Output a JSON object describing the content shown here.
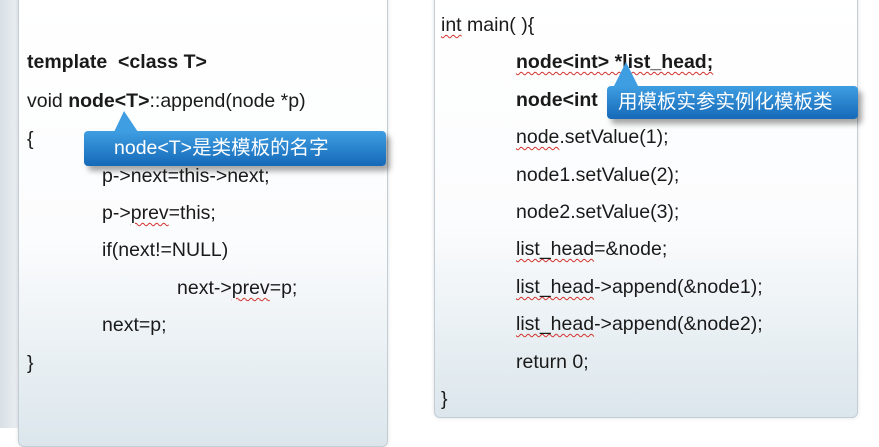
{
  "left_code": {
    "template_line": {
      "keyword": "template",
      "gap": "  ",
      "params": "<class T>"
    },
    "void_line": {
      "void": "void ",
      "node_t": "node<T>",
      "rest": "::append(node *p)"
    },
    "open_brace": "{",
    "line_next": {
      "part1": "p->",
      "part2": "next=this->next;"
    },
    "line_prev": {
      "part1": "p->",
      "prev": "prev",
      "part2": "=this;"
    },
    "line_if": "if(next!=NULL)",
    "line_next_prev": {
      "part1": "next->",
      "prev": "prev",
      "part2": "=p;"
    },
    "line_next_eq": "next=p;",
    "close_brace": "}"
  },
  "right_code": {
    "main_line": {
      "int": "int",
      "rest": " main( ){"
    },
    "decl1": {
      "text": "node<int> *list_head;"
    },
    "decl2": {
      "text": "node<int"
    },
    "set1": {
      "node": "node",
      "rest": ".setValue(1);"
    },
    "set2": "node1.setValue(2);",
    "set3": "node2.setValue(3);",
    "assign": {
      "list_head": "list_head",
      "rest": "=&node;"
    },
    "append1": {
      "list_head": "list_head",
      "rest": "->append(&node1);"
    },
    "append2": {
      "list_head": "list_head",
      "rest": "->append(&node2);"
    },
    "ret": "return 0;",
    "close_brace": "}"
  },
  "callouts": {
    "node_name": "node<T>是类模板的名字",
    "instantiate": "用模板实参实例化模板类"
  },
  "colors": {
    "callout_blue_top": "#3f9ee2",
    "callout_blue_bottom": "#1569b8",
    "spellcheck_red": "#d2312c"
  }
}
